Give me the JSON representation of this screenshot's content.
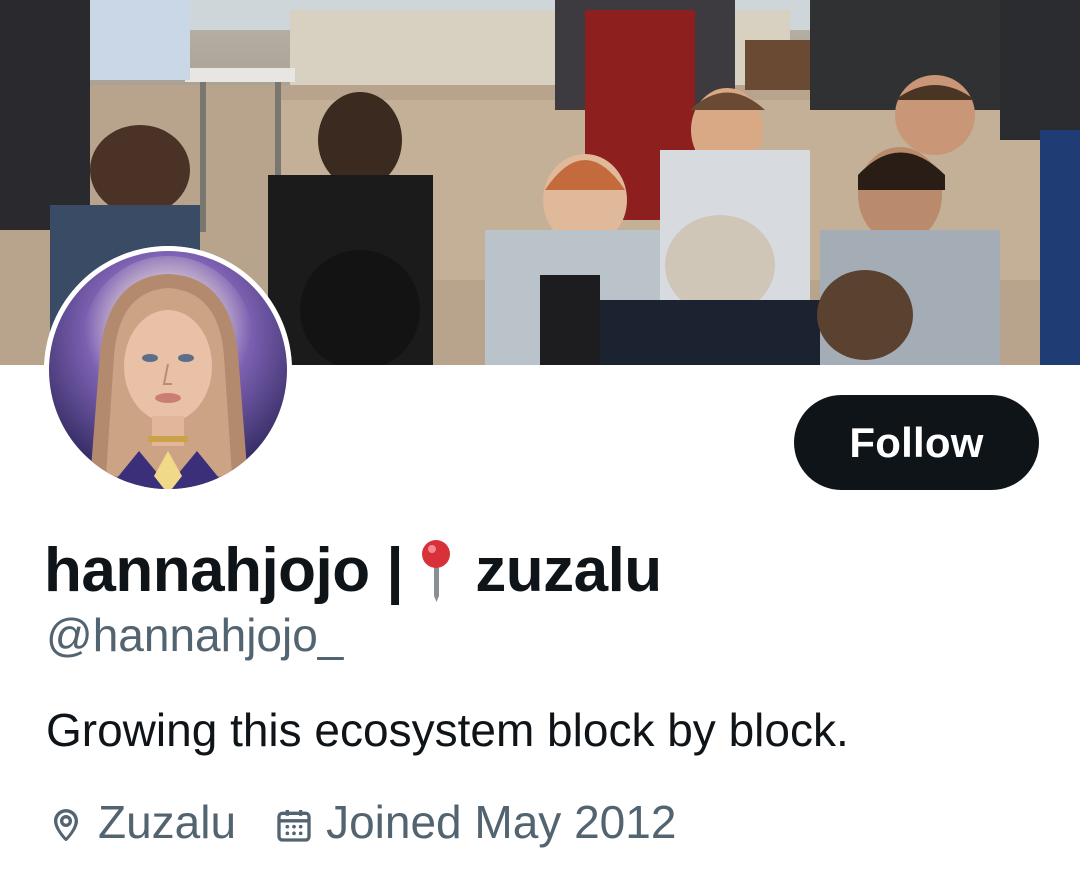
{
  "profile": {
    "display_name_prefix": "hannahjojo |",
    "display_name_emoji": "round-pushpin-icon",
    "display_name_suffix": "zuzalu",
    "handle": "@hannahjojo_",
    "bio": "Growing this ecosystem block by block.",
    "location": "Zuzalu",
    "joined": "Joined May 2012"
  },
  "actions": {
    "follow_label": "Follow"
  },
  "icons": {
    "location": "location-pin-icon",
    "calendar": "calendar-icon"
  },
  "colors": {
    "text_primary": "#0f1419",
    "text_secondary": "#536471",
    "button_bg": "#0f1419",
    "button_text": "#ffffff",
    "background": "#ffffff"
  }
}
